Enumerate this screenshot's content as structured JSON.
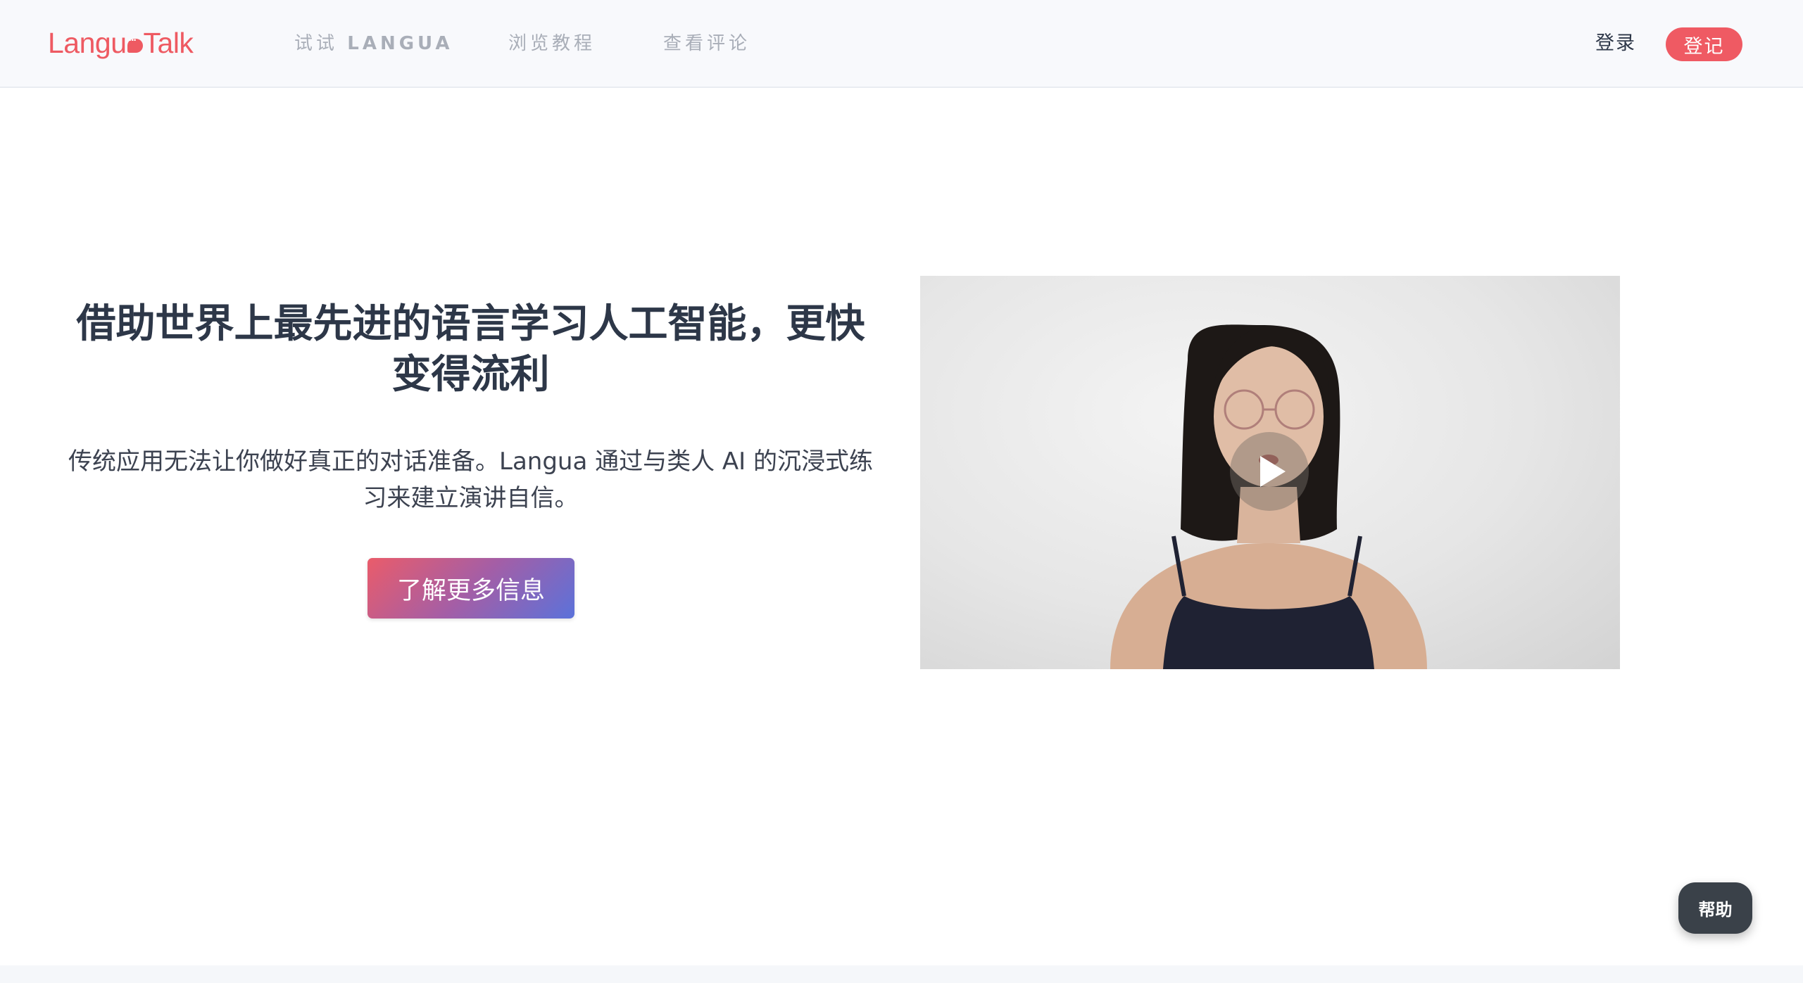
{
  "header": {
    "logo": {
      "part1": "Langu",
      "part2": "Talk"
    },
    "nav": [
      {
        "label_prefix": "试试 ",
        "label_strong": "LANGUA"
      },
      {
        "label": "浏览教程"
      },
      {
        "label": "查看评论"
      }
    ],
    "login_label": "登录",
    "signup_label": "登记",
    "accent_color": "#ef5a63"
  },
  "hero": {
    "title": "借助世界上最先进的语言学习人工智能，更快变得流利",
    "subtitle": "传统应用无法让你做好真正的对话准备。Langua 通过与类人 AI 的沉浸式练习来建立演讲自信。",
    "cta_label": "了解更多信息"
  },
  "video": {
    "play_icon": "play-icon"
  },
  "help": {
    "label": "帮助"
  }
}
